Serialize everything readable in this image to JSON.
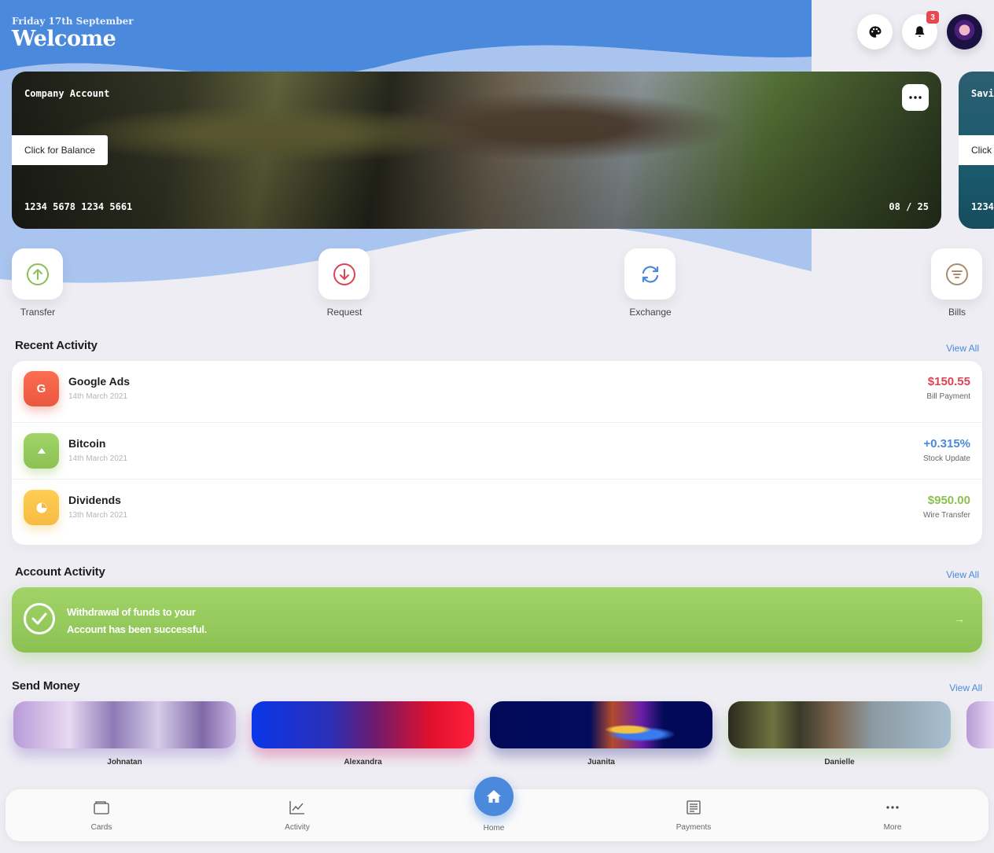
{
  "header": {
    "date": "Friday 17th September",
    "title": "Welcome",
    "notification_count": "3",
    "colors": {
      "accent": "#4A89DC"
    }
  },
  "cards": [
    {
      "name": "Company Account",
      "button": "Click for Balance",
      "number": "1234 5678 1234 5661",
      "expiry": "08 / 25"
    },
    {
      "name": "Savi",
      "button": "Click f",
      "number": "1234"
    }
  ],
  "quick_actions": [
    {
      "label": "Transfer",
      "icon": "arrow-up-circle-icon",
      "color": "#8CC152"
    },
    {
      "label": "Request",
      "icon": "arrow-down-circle-icon",
      "color": "#DA4453"
    },
    {
      "label": "Exchange",
      "icon": "refresh-icon",
      "color": "#4A89DC"
    },
    {
      "label": "Bills",
      "icon": "filter-icon",
      "color": "#AA8E69"
    }
  ],
  "recent_activity": {
    "title": "Recent Activity",
    "view_all": "View All",
    "items": [
      {
        "name": "Google Ads",
        "date": "14th March 2021",
        "amount": "$150.55",
        "type": "Bill Payment",
        "icon_letter": "G",
        "color": "#DA4453"
      },
      {
        "name": "Bitcoin",
        "date": "14th March 2021",
        "amount": "+0.315%",
        "type": "Stock Update",
        "icon": "caret-up-icon",
        "color": "#4A89DC"
      },
      {
        "name": "Dividends",
        "date": "13th March 2021",
        "amount": "$950.00",
        "type": "Wire Transfer",
        "icon": "pie-chart-icon",
        "color": "#8CC152"
      }
    ]
  },
  "account_activity": {
    "title": "Account Activity",
    "view_all": "View All",
    "message_line1": "Withdrawal of funds to your",
    "message_line2": "Account has been successful."
  },
  "send_money": {
    "title": "Send Money",
    "view_all": "View All",
    "people": [
      "Johnatan",
      "Alexandra",
      "Juanita",
      "Danielle"
    ]
  },
  "nav": {
    "items": [
      "Cards",
      "Activity",
      "Home",
      "Payments",
      "More"
    ]
  }
}
